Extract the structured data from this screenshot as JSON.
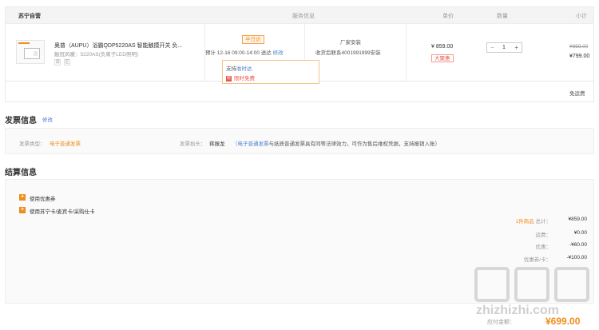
{
  "header": {
    "store": "苏宁自营",
    "service_col": "服务信息",
    "price_col": "单价",
    "qty_col": "数量",
    "subtotal_col": "小计"
  },
  "product": {
    "title": "奥普（AUPU）浴霸QDP5220AS 智能触摸开关 负...",
    "spec": "触冠风暖：5220AS(负离子LED照明)",
    "tags": [
      "调",
      "区"
    ],
    "delivery_badge": "半日达",
    "delivery_time": "预计 12-16 09:00-14:00 送达",
    "delivery_edit": "修改",
    "promo_support": "支持",
    "promo_support_link": "准时达",
    "promo_free_icon": "限",
    "promo_free": "限时免费",
    "service_1": "厂家安装",
    "service_2": "收货后联系4001991999安装",
    "price": "¥ 859.00",
    "promo_badge": "大聚惠",
    "quantity": "1",
    "minus": "−",
    "plus": "+",
    "original_subtotal": "¥859.00",
    "subtotal": "¥799.00",
    "free_shipping": "免运费"
  },
  "invoice": {
    "title": "发票信息",
    "edit": "修改",
    "type_label": "发票类型：",
    "type_value": "电子普通发票",
    "header_label": "发票抬头：",
    "header_value": "蒋振龙",
    "note_highlight": "（电子普通发票",
    "note_rest": "与纸质普通发票具有同等法律效力，可作为售后维权凭据，支持报销入账）"
  },
  "settlement": {
    "title": "结算信息",
    "coupon": "使用优惠券",
    "cards": "使用苏宁卡/麦宾卡/采购仕卡",
    "summary": [
      {
        "label": "1件商品 总计：",
        "value": "¥859.00"
      },
      {
        "label": "运费：",
        "value": "¥0.00"
      },
      {
        "label": "优惠：",
        "value": "-¥60.00"
      },
      {
        "label": "优惠券/卡：",
        "value": "-¥100.00"
      }
    ],
    "total_label": "应付金额：",
    "total_value": "¥699.00"
  },
  "watermark": "zhizhizhi.com",
  "colors": {
    "accent": "#f08c1a",
    "link": "#4a7fcf",
    "red": "#e8544a"
  }
}
